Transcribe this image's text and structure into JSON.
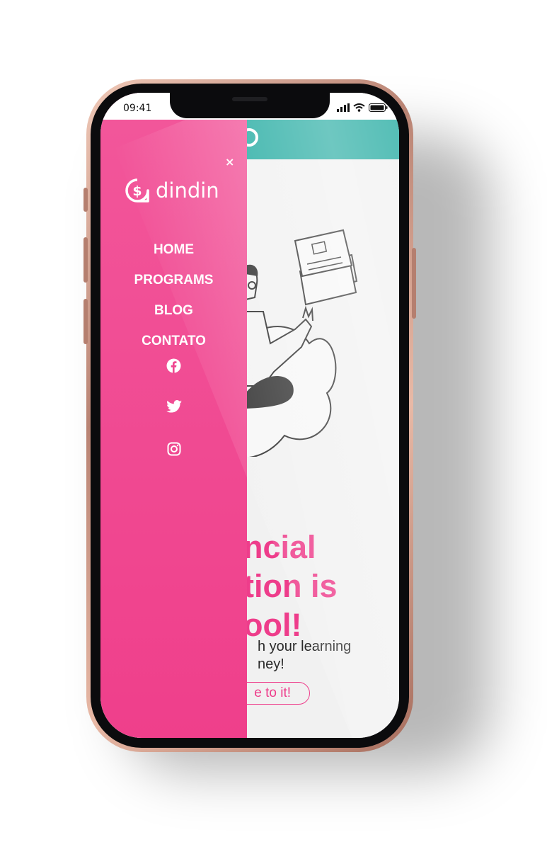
{
  "status_bar": {
    "time": "09:41"
  },
  "drawer": {
    "brand": "dindin",
    "close_label": "×",
    "nav_items": [
      {
        "label": "HOME"
      },
      {
        "label": "PROGRAMS"
      },
      {
        "label": "BLOG"
      },
      {
        "label": "CONTATO"
      }
    ],
    "social_icons": [
      "facebook-icon",
      "twitter-icon",
      "instagram-icon"
    ]
  },
  "hero": {
    "title_line_1": "ncial",
    "title_line_2": "tion is",
    "title_line_3": "ool!",
    "subtitle_line_1": "h your learning",
    "subtitle_line_2": "ney!",
    "cta_label": "e to it!"
  },
  "colors": {
    "drawer_pink": "#ef3f8b",
    "header_teal": "#21aaa0",
    "accent_pink": "#ee3d8b"
  }
}
